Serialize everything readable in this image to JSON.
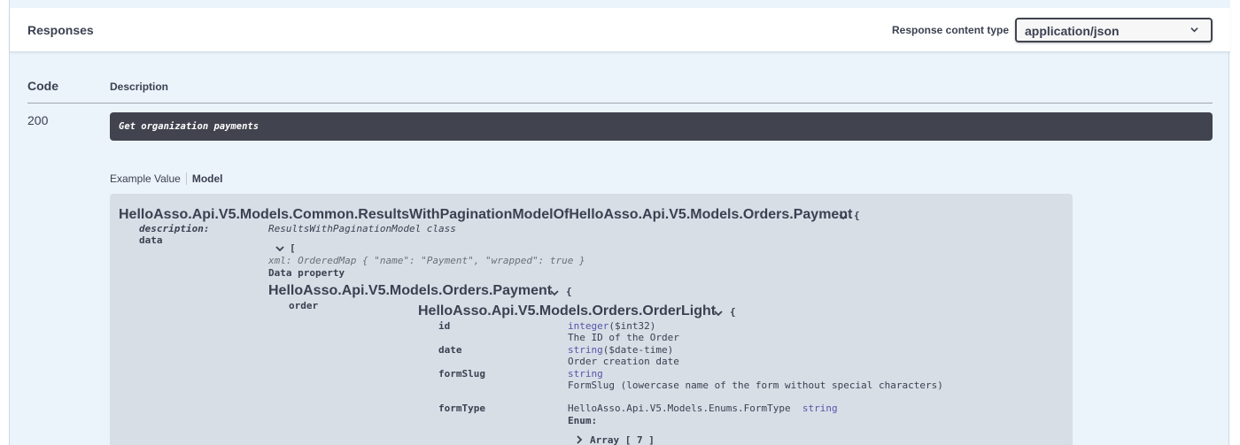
{
  "responses": {
    "title": "Responses",
    "content_type_label": "Response content type",
    "content_type_value": "application/json"
  },
  "table": {
    "code_header": "Code",
    "description_header": "Description",
    "code": "200",
    "description": "Get organization payments"
  },
  "tabs": {
    "example_value": "Example Value",
    "model": "Model"
  },
  "model": {
    "root_title": "HelloAsso.Api.V5.Models.Common.ResultsWithPaginationModelOfHelloAsso.Api.V5.Models.Orders.Payment",
    "open_brace": "{",
    "open_bracket": "[",
    "description_key": "description:",
    "description_value": "ResultsWithPaginationModel class",
    "data_key": "data",
    "xml_line": "xml: OrderedMap { \"name\": \"Payment\", \"wrapped\": true }",
    "data_property": "Data property",
    "payment_title": "HelloAsso.Api.V5.Models.Orders.Payment",
    "order_key": "order",
    "order_title": "HelloAsso.Api.V5.Models.Orders.OrderLight",
    "fields": {
      "id_key": "id",
      "id_type": "integer",
      "id_format": "($int32)",
      "id_desc": "The ID of the Order",
      "date_key": "date",
      "date_type": "string",
      "date_format": "($date-time)",
      "date_desc": "Order creation date",
      "formslug_key": "formSlug",
      "formslug_type": "string",
      "formslug_desc": "FormSlug (lowercase name of the form without special characters)",
      "formtype_key": "formType",
      "formtype_model": "HelloAsso.Api.V5.Models.Enums.FormType",
      "formtype_type": "string",
      "enum_label": "Enum:",
      "array_label": "Array [ 7 ]"
    }
  },
  "icons": {
    "select_chevron": "chevron-down-icon",
    "model_chevron": "chevron-down-icon",
    "array_chevron": "chevron-right-icon"
  },
  "colors": {
    "background": "#ebf3fb",
    "description_box": "#41444e",
    "model_box": "#d8dee6",
    "type_text": "#55aa"
  }
}
